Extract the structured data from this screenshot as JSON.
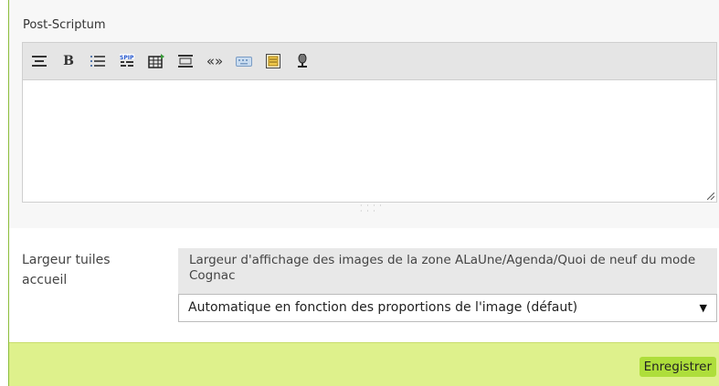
{
  "post_scriptum": {
    "label": "Post-Scriptum",
    "toolbar": [
      {
        "icon": "align-center-icon"
      },
      {
        "icon": "bold-icon",
        "glyph": "B"
      },
      {
        "icon": "bullet-list-icon"
      },
      {
        "icon": "spip-code-icon"
      },
      {
        "icon": "insert-table-icon"
      },
      {
        "icon": "center-paragraph-icon"
      },
      {
        "icon": "quote-icon",
        "glyph": "«»"
      },
      {
        "icon": "keyboard-icon"
      },
      {
        "icon": "preview-icon"
      },
      {
        "icon": "microphone-icon"
      }
    ],
    "value": ""
  },
  "tile_width": {
    "label": "Largeur tuiles accueil",
    "explanation": "Largeur d'affichage des images de la zone ALaUne/Agenda/Quoi de neuf du mode Cognac",
    "selected": "Automatique en fonction des proportions de l'image (défaut)"
  },
  "footer": {
    "save_label": "Enregistrer"
  },
  "colors": {
    "footer_bg": "#def18c",
    "save_button_bg": "#aede3b",
    "accent_rule": "#8cbd3a"
  }
}
